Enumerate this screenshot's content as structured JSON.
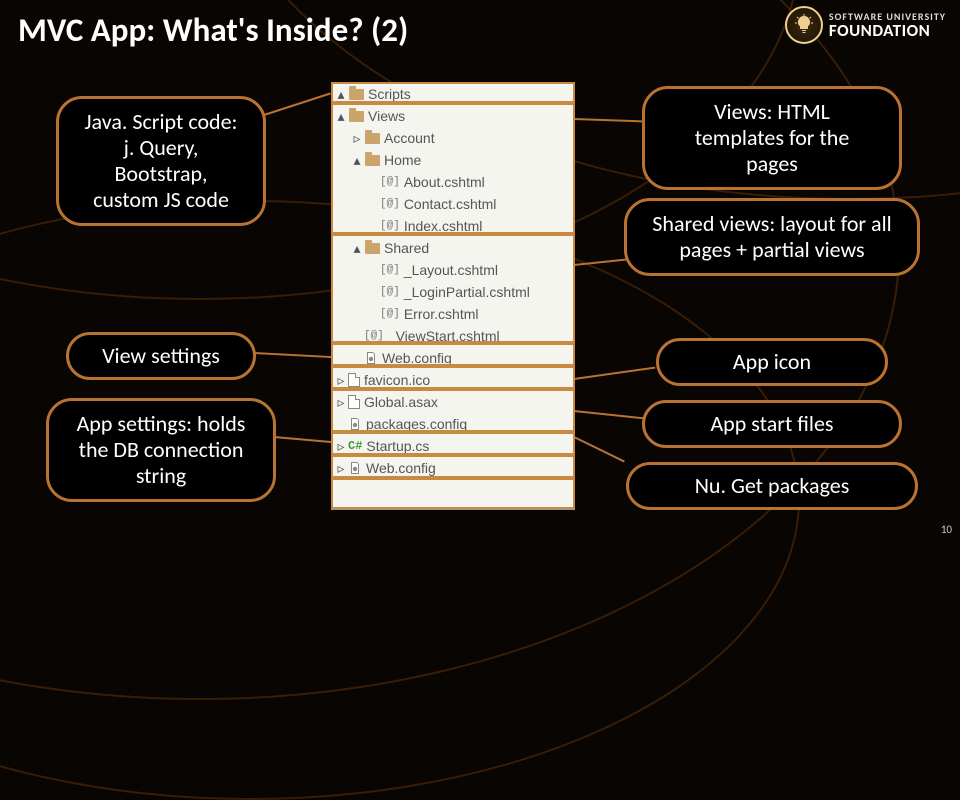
{
  "title": "MVC App: What's Inside? (2)",
  "logo": {
    "top": "SOFTWARE UNIVERSITY",
    "bottom": "FOUNDATION"
  },
  "bubbles": {
    "js": "Java. Script code:\nj. Query, Bootstrap, custom JS code",
    "vset": "View settings",
    "app": "App settings: holds the DB connection string",
    "views": "Views:\nHTML templates for the pages",
    "shared": "Shared views: layout for all pages + partial views",
    "icon": "App icon",
    "start": "App start files",
    "nuget": "Nu. Get packages"
  },
  "tree": [
    {
      "d": 0,
      "arrow": "▴",
      "kind": "folder",
      "label": "Scripts"
    },
    {
      "d": 0,
      "arrow": "▴",
      "kind": "folder",
      "label": "Views"
    },
    {
      "d": 1,
      "arrow": "▹",
      "kind": "folder",
      "label": "Account"
    },
    {
      "d": 1,
      "arrow": "▴",
      "kind": "folder",
      "label": "Home"
    },
    {
      "d": 2,
      "arrow": "",
      "kind": "razor",
      "label": "About.cshtml"
    },
    {
      "d": 2,
      "arrow": "",
      "kind": "razor",
      "label": "Contact.cshtml"
    },
    {
      "d": 2,
      "arrow": "",
      "kind": "razor",
      "label": "Index.cshtml"
    },
    {
      "d": 1,
      "arrow": "▴",
      "kind": "folder",
      "label": "Shared"
    },
    {
      "d": 2,
      "arrow": "",
      "kind": "razor",
      "label": "_Layout.cshtml"
    },
    {
      "d": 2,
      "arrow": "",
      "kind": "razor",
      "label": "_LoginPartial.cshtml"
    },
    {
      "d": 2,
      "arrow": "",
      "kind": "razor",
      "label": "Error.cshtml"
    },
    {
      "d": 1,
      "arrow": "",
      "kind": "razor",
      "label": "_ViewStart.cshtml"
    },
    {
      "d": 1,
      "arrow": "",
      "kind": "config",
      "label": "Web.config"
    },
    {
      "d": 0,
      "arrow": "▹",
      "kind": "file",
      "label": "favicon.ico"
    },
    {
      "d": 0,
      "arrow": "▹",
      "kind": "file",
      "label": "Global.asax"
    },
    {
      "d": 0,
      "arrow": "",
      "kind": "config",
      "label": "packages.config"
    },
    {
      "d": 0,
      "arrow": "▹",
      "kind": "cs",
      "label": "Startup.cs"
    },
    {
      "d": 0,
      "arrow": "▹",
      "kind": "config",
      "label": "Web.config"
    }
  ],
  "page_number": "10"
}
